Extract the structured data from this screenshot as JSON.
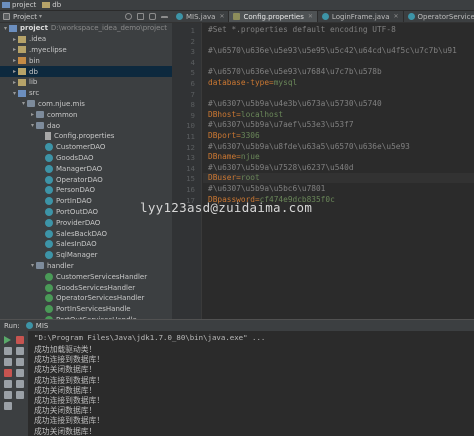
{
  "breadcrumb": [
    "project",
    "db"
  ],
  "project_panel": {
    "label": "Project",
    "tool_icons": [
      "target-icon",
      "settings-icon",
      "pin-icon",
      "hide-icon"
    ]
  },
  "tree": [
    {
      "label": "project",
      "detail": "D:\\workspace_idea_demo\\project",
      "indent": 0,
      "arrow": "▾",
      "icon": "folder-blue",
      "bold": true
    },
    {
      "label": ".idea",
      "indent": 1,
      "arrow": "▸",
      "icon": "folder"
    },
    {
      "label": ".myeclipse",
      "indent": 1,
      "arrow": "▸",
      "icon": "folder"
    },
    {
      "label": "bin",
      "indent": 1,
      "arrow": "▸",
      "icon": "folder-orange"
    },
    {
      "label": "db",
      "indent": 1,
      "arrow": "▸",
      "icon": "folder",
      "selected": true
    },
    {
      "label": "lib",
      "indent": 1,
      "arrow": "▸",
      "icon": "folder"
    },
    {
      "label": "src",
      "indent": 1,
      "arrow": "▾",
      "icon": "folder-blue"
    },
    {
      "label": "com.njue.mis",
      "indent": 2,
      "arrow": "▾",
      "icon": "pkg"
    },
    {
      "label": "common",
      "indent": 3,
      "arrow": "▸",
      "icon": "pkg"
    },
    {
      "label": "dao",
      "indent": 3,
      "arrow": "▾",
      "icon": "pkg"
    },
    {
      "label": "Config.properties",
      "indent": 4,
      "arrow": "",
      "icon": "file"
    },
    {
      "label": "CustomerDAO",
      "indent": 4,
      "arrow": "",
      "icon": "cls"
    },
    {
      "label": "GoodsDAO",
      "indent": 4,
      "arrow": "",
      "icon": "cls"
    },
    {
      "label": "ManagerDAO",
      "indent": 4,
      "arrow": "",
      "icon": "cls"
    },
    {
      "label": "OperatorDAO",
      "indent": 4,
      "arrow": "",
      "icon": "cls"
    },
    {
      "label": "PersonDAO",
      "indent": 4,
      "arrow": "",
      "icon": "cls"
    },
    {
      "label": "PortInDAO",
      "indent": 4,
      "arrow": "",
      "icon": "cls"
    },
    {
      "label": "PortOutDAO",
      "indent": 4,
      "arrow": "",
      "icon": "cls"
    },
    {
      "label": "ProviderDAO",
      "indent": 4,
      "arrow": "",
      "icon": "cls"
    },
    {
      "label": "SalesBackDAO",
      "indent": 4,
      "arrow": "",
      "icon": "cls"
    },
    {
      "label": "SalesInDAO",
      "indent": 4,
      "arrow": "",
      "icon": "cls"
    },
    {
      "label": "SqlManager",
      "indent": 4,
      "arrow": "",
      "icon": "cls"
    },
    {
      "label": "handler",
      "indent": 3,
      "arrow": "▾",
      "icon": "pkg"
    },
    {
      "label": "CustomerServicesHandler",
      "indent": 4,
      "arrow": "",
      "icon": "gcls"
    },
    {
      "label": "GoodsServicesHandler",
      "indent": 4,
      "arrow": "",
      "icon": "gcls"
    },
    {
      "label": "OperatorServicesHandler",
      "indent": 4,
      "arrow": "",
      "icon": "gcls"
    },
    {
      "label": "PortInServicesHandle",
      "indent": 4,
      "arrow": "",
      "icon": "gcls"
    },
    {
      "label": "PortOutServicesHandle",
      "indent": 4,
      "arrow": "",
      "icon": "gcls"
    }
  ],
  "tabs": [
    {
      "label": "MIS.java",
      "icon": "class",
      "active": false
    },
    {
      "label": "Config.properties",
      "icon": "prop",
      "active": true
    },
    {
      "label": "LoginFrame.java",
      "icon": "class",
      "active": false
    },
    {
      "label": "OperatorServicesHandler.java",
      "icon": "class",
      "active": false
    }
  ],
  "editor": {
    "line_numbers": [
      "1",
      "2",
      "3",
      "4",
      "5",
      "6",
      "7",
      "8",
      "9",
      "10",
      "11",
      "12",
      "13",
      "14",
      "15",
      "16",
      "17"
    ],
    "lines": [
      {
        "type": "comment",
        "text": "#Set *.properties default encoding UTF-8"
      },
      {
        "type": "blank",
        "text": ""
      },
      {
        "type": "comment",
        "text": "#\\u6570\\u636e\\u5e93\\u5e95\\u5c42\\u64cd\\u4f5c\\u7c7b\\u91"
      },
      {
        "type": "blank",
        "text": ""
      },
      {
        "type": "comment",
        "text": "#\\u6570\\u636e\\u5e93\\u7684\\u7c7b\\u578b"
      },
      {
        "type": "kv",
        "key": "database-type",
        "value": "mysql"
      },
      {
        "type": "blank",
        "text": ""
      },
      {
        "type": "comment",
        "text": "#\\u6307\\u5b9a\\u4e3b\\u673a\\u5730\\u5740"
      },
      {
        "type": "kv",
        "key": "DBhost",
        "value": "localhost"
      },
      {
        "type": "comment",
        "text": "#\\u6307\\u5b9a\\u7aef\\u53e3\\u53f7"
      },
      {
        "type": "kv",
        "key": "DBport",
        "value": "3306"
      },
      {
        "type": "comment",
        "text": "#\\u6307\\u5b9a\\u8fde\\u63a5\\u6570\\u636e\\u5e93"
      },
      {
        "type": "kv",
        "key": "DBname",
        "value": "njue"
      },
      {
        "type": "comment",
        "text": "#\\u6307\\u5b9a\\u7528\\u6237\\u540d"
      },
      {
        "type": "kv",
        "key": "DBuser",
        "value": "root",
        "highlight": true
      },
      {
        "type": "comment",
        "text": "#\\u6307\\u5b9a\\u5bc6\\u7801"
      },
      {
        "type": "kv",
        "key": "DBpassword",
        "value": "cf474e9dcb835f0c"
      }
    ]
  },
  "watermark": "lyy123asd@zuidaima.com",
  "run": {
    "label": "Run:",
    "config": "MIS",
    "command": "\"D:\\Program Files\\Java\\jdk1.7.0_80\\bin\\java.exe\" ...",
    "output": [
      "成功加载驱动类！",
      "成功连接到数据库！",
      "成功关闭数据库！",
      "成功连接到数据库！",
      "成功关闭数据库！",
      "成功连接到数据库！",
      "成功关闭数据库！",
      "成功连接到数据库！",
      "成功关闭数据库！"
    ],
    "tool_icons": [
      "rerun-icon",
      "stop-icon",
      "pause-icon",
      "dump-icon",
      "settings-icon",
      "pin-icon",
      "close-icon",
      "help-icon",
      "scroll-icon",
      "print-icon",
      "clear-icon",
      "up-icon",
      "down-icon"
    ]
  },
  "colors": {
    "bg": "#2b2b2b",
    "panel": "#3c3f41",
    "comment": "#808080",
    "key": "#cc7832",
    "value": "#6a8759",
    "selection": "#0d293e"
  }
}
